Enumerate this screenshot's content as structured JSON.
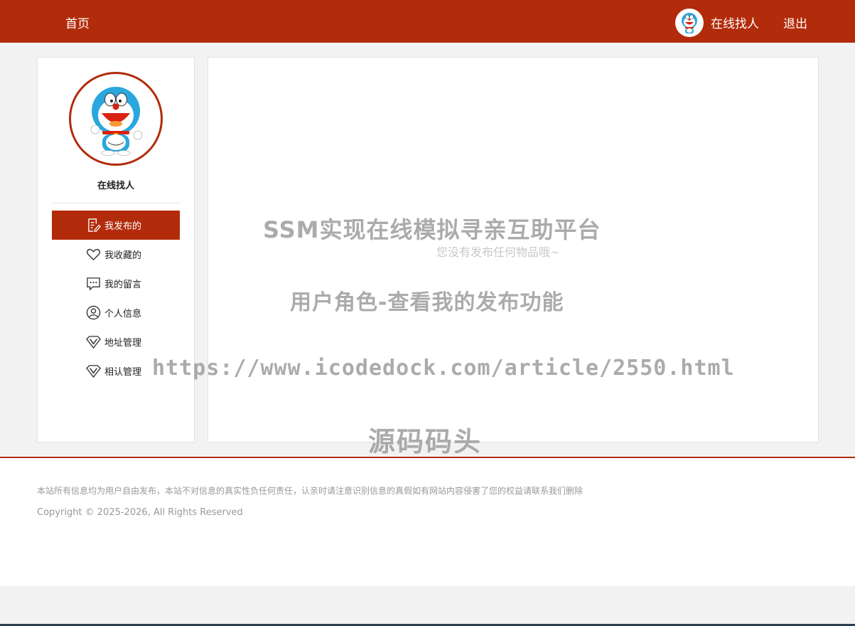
{
  "header": {
    "home_label": "首页",
    "username": "在线找人",
    "logout_label": "退出"
  },
  "sidebar": {
    "username": "在线找人",
    "items": [
      {
        "label": "我发布的",
        "icon": "document-edit-icon",
        "active": true
      },
      {
        "label": "我收藏的",
        "icon": "heart-icon",
        "active": false
      },
      {
        "label": "我的留言",
        "icon": "chat-bubble-icon",
        "active": false
      },
      {
        "label": "个人信息",
        "icon": "user-icon",
        "active": false
      },
      {
        "label": "地址管理",
        "icon": "diamond-v-icon",
        "active": false
      },
      {
        "label": "相认管理",
        "icon": "diamond-v-icon",
        "active": false
      }
    ]
  },
  "main": {
    "empty_message": "您没有发布任何物品哦~"
  },
  "watermark": {
    "title": "SSM实现在线模拟寻亲互助平台",
    "subtitle": "用户角色-查看我的发布功能",
    "url": "https://www.icodedock.com/article/2550.html",
    "brand": "源码码头"
  },
  "footer": {
    "notice": "本站所有信息均为用户自由发布，本站不对信息的真实性负任何责任，认亲时请注意识别信息的真假如有网站内容侵害了您的权益请联系我们删除",
    "copyright": "Copyright © 2025-2026, All Rights Reserved"
  },
  "colors": {
    "brand": "#b22b0b",
    "background": "#f2f2f2"
  }
}
